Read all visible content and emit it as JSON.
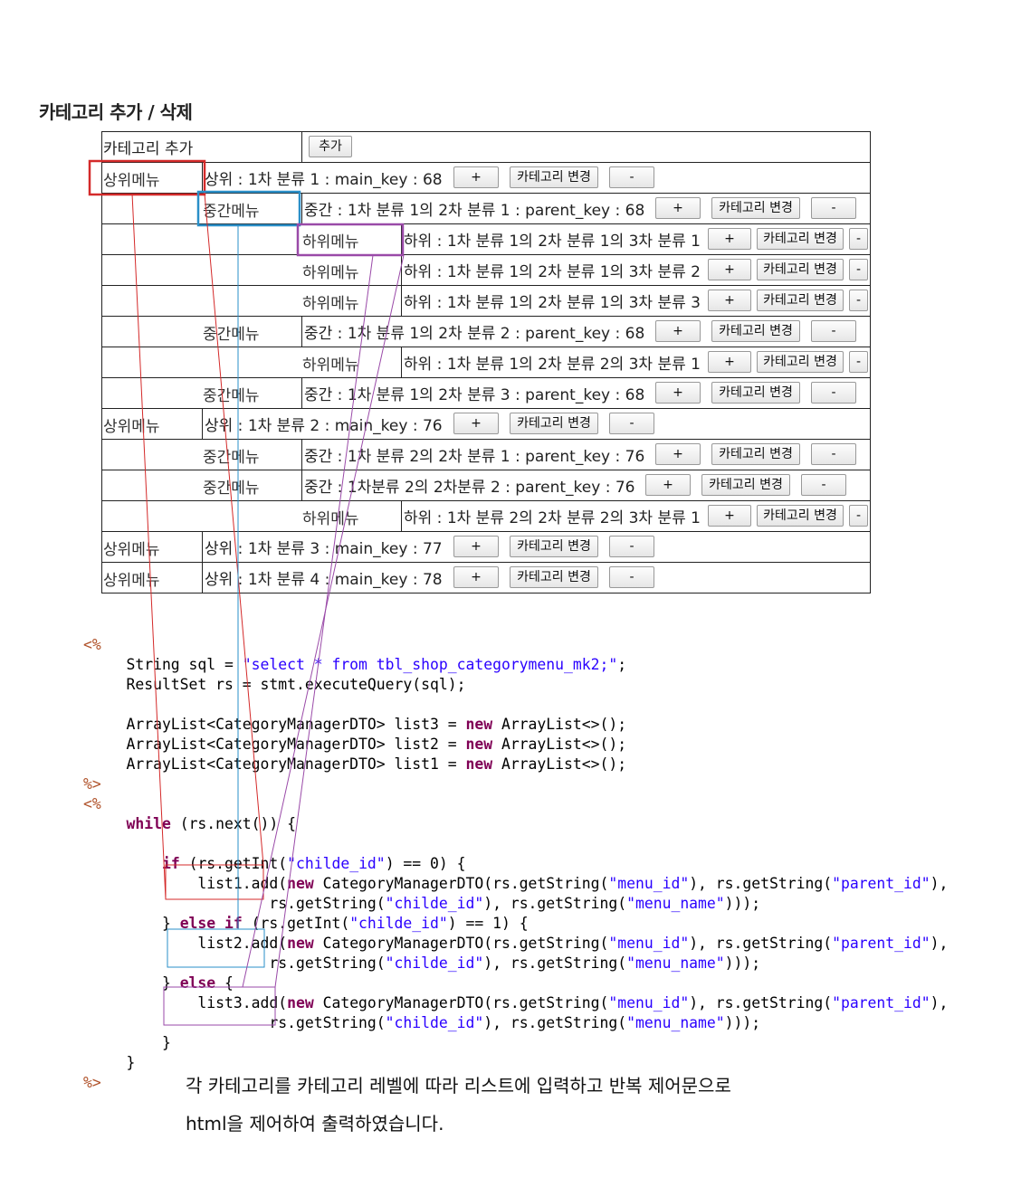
{
  "title": "카테고리 추가 / 삭제",
  "header": {
    "label": "카테고리 추가",
    "add_button": "추가"
  },
  "buttons": {
    "plus": "+",
    "change": "카테고리 변경",
    "minus": "-"
  },
  "rows": [
    {
      "level": 1,
      "label": "상위메뉴",
      "text": "상위 : 1차 분류 1 : main_key : 68"
    },
    {
      "level": 2,
      "label": "중간메뉴",
      "text": "중간 : 1차 분류 1의 2차 분류 1 : parent_key : 68"
    },
    {
      "level": 3,
      "label": "하위메뉴",
      "text": "하위 : 1차 분류 1의 2차 분류 1의 3차 분류 1"
    },
    {
      "level": 3,
      "label": "하위메뉴",
      "text": "하위 : 1차 분류 1의 2차 분류 1의 3차 분류 2"
    },
    {
      "level": 3,
      "label": "하위메뉴",
      "text": "하위 : 1차 분류 1의 2차 분류 1의 3차 분류 3"
    },
    {
      "level": 2,
      "label": "중간메뉴",
      "text": "중간 : 1차 분류 1의 2차 분류 2 : parent_key : 68"
    },
    {
      "level": 3,
      "label": "하위메뉴",
      "text": "하위 : 1차 분류 1의 2차 분류 2의 3차 분류 1"
    },
    {
      "level": 2,
      "label": "중간메뉴",
      "text": "중간 : 1차 분류 1의 2차 분류 3 : parent_key : 68"
    },
    {
      "level": 1,
      "label": "상위메뉴",
      "text": "상위 : 1차 분류 2 : main_key : 76"
    },
    {
      "level": 2,
      "label": "중간메뉴",
      "text": "중간 : 1차 분류 2의 2차 분류 1 : parent_key : 76"
    },
    {
      "level": 2,
      "label": "중간메뉴",
      "text": "중간 : 1차분류 2의 2차분류 2 : parent_key : 76"
    },
    {
      "level": 3,
      "label": "하위메뉴",
      "text": "하위 : 1차 분류 2의 2차 분류 2의 3차 분류 1"
    },
    {
      "level": 1,
      "label": "상위메뉴",
      "text": "상위 : 1차 분류 3 : main_key : 77"
    },
    {
      "level": 1,
      "label": "상위메뉴",
      "text": "상위 : 1차 분류 4 : main_key : 78"
    }
  ],
  "code": [
    [
      [
        "tag",
        "<%"
      ]
    ],
    [
      [
        "t",
        "    String sql = "
      ],
      [
        "str",
        "\"select * from tbl_shop_categorymenu_mk2;\""
      ],
      [
        "t",
        ";"
      ]
    ],
    [
      [
        "t",
        "    ResultSet rs = stmt.executeQuery(sql);"
      ]
    ],
    [
      [
        "t",
        ""
      ]
    ],
    [
      [
        "t",
        "    ArrayList<CategoryManagerDTO> list3 = "
      ],
      [
        "kw",
        "new"
      ],
      [
        "t",
        " ArrayList<>();"
      ]
    ],
    [
      [
        "t",
        "    ArrayList<CategoryManagerDTO> list2 = "
      ],
      [
        "kw",
        "new"
      ],
      [
        "t",
        " ArrayList<>();"
      ]
    ],
    [
      [
        "t",
        "    ArrayList<CategoryManagerDTO> list1 = "
      ],
      [
        "kw",
        "new"
      ],
      [
        "t",
        " ArrayList<>();"
      ]
    ],
    [
      [
        "tag",
        "%>"
      ]
    ],
    [
      [
        "tag",
        "<%"
      ]
    ],
    [
      [
        "t",
        "    "
      ],
      [
        "kw",
        "while"
      ],
      [
        "t",
        " (rs.next()) {"
      ]
    ],
    [
      [
        "t",
        ""
      ]
    ],
    [
      [
        "t",
        "        "
      ],
      [
        "kw",
        "if"
      ],
      [
        "t",
        " (rs.getInt("
      ],
      [
        "str",
        "\"childe_id\""
      ],
      [
        "t",
        ") == 0) {"
      ]
    ],
    [
      [
        "t",
        "            list1.add("
      ],
      [
        "kw",
        "new"
      ],
      [
        "t",
        " CategoryManagerDTO(rs.getString("
      ],
      [
        "str",
        "\"menu_id\""
      ],
      [
        "t",
        "), rs.getString("
      ],
      [
        "str",
        "\"parent_id\""
      ],
      [
        "t",
        "),"
      ]
    ],
    [
      [
        "t",
        "                    rs.getString("
      ],
      [
        "str",
        "\"childe_id\""
      ],
      [
        "t",
        "), rs.getString("
      ],
      [
        "str",
        "\"menu_name\""
      ],
      [
        "t",
        ")));"
      ]
    ],
    [
      [
        "t",
        "        } "
      ],
      [
        "kw",
        "else if"
      ],
      [
        "t",
        " (rs.getInt("
      ],
      [
        "str",
        "\"childe_id\""
      ],
      [
        "t",
        ") == 1) {"
      ]
    ],
    [
      [
        "t",
        "            list2.add("
      ],
      [
        "kw",
        "new"
      ],
      [
        "t",
        " CategoryManagerDTO(rs.getString("
      ],
      [
        "str",
        "\"menu_id\""
      ],
      [
        "t",
        "), rs.getString("
      ],
      [
        "str",
        "\"parent_id\""
      ],
      [
        "t",
        "),"
      ]
    ],
    [
      [
        "t",
        "                    rs.getString("
      ],
      [
        "str",
        "\"childe_id\""
      ],
      [
        "t",
        "), rs.getString("
      ],
      [
        "str",
        "\"menu_name\""
      ],
      [
        "t",
        ")));"
      ]
    ],
    [
      [
        "t",
        "        } "
      ],
      [
        "kw",
        "else"
      ],
      [
        "t",
        " {"
      ]
    ],
    [
      [
        "t",
        "            list3.add("
      ],
      [
        "kw",
        "new"
      ],
      [
        "t",
        " CategoryManagerDTO(rs.getString("
      ],
      [
        "str",
        "\"menu_id\""
      ],
      [
        "t",
        "), rs.getString("
      ],
      [
        "str",
        "\"parent_id\""
      ],
      [
        "t",
        "),"
      ]
    ],
    [
      [
        "t",
        "                    rs.getString("
      ],
      [
        "str",
        "\"childe_id\""
      ],
      [
        "t",
        "), rs.getString("
      ],
      [
        "str",
        "\"menu_name\""
      ],
      [
        "t",
        ")));"
      ]
    ],
    [
      [
        "t",
        "        }"
      ]
    ],
    [
      [
        "t",
        "    }"
      ]
    ],
    [
      [
        "tag",
        "%>"
      ]
    ]
  ],
  "description": {
    "line1": "각 카테고리를 카테고리 레벨에 따라 리스트에 입력하고 반복 제어문으로",
    "line2": "html을 제어하여 출력하였습니다."
  },
  "colors": {
    "level1_highlight": "#d42a2a",
    "level2_highlight": "#2a8fc8",
    "level3_highlight": "#9a4aa8"
  }
}
